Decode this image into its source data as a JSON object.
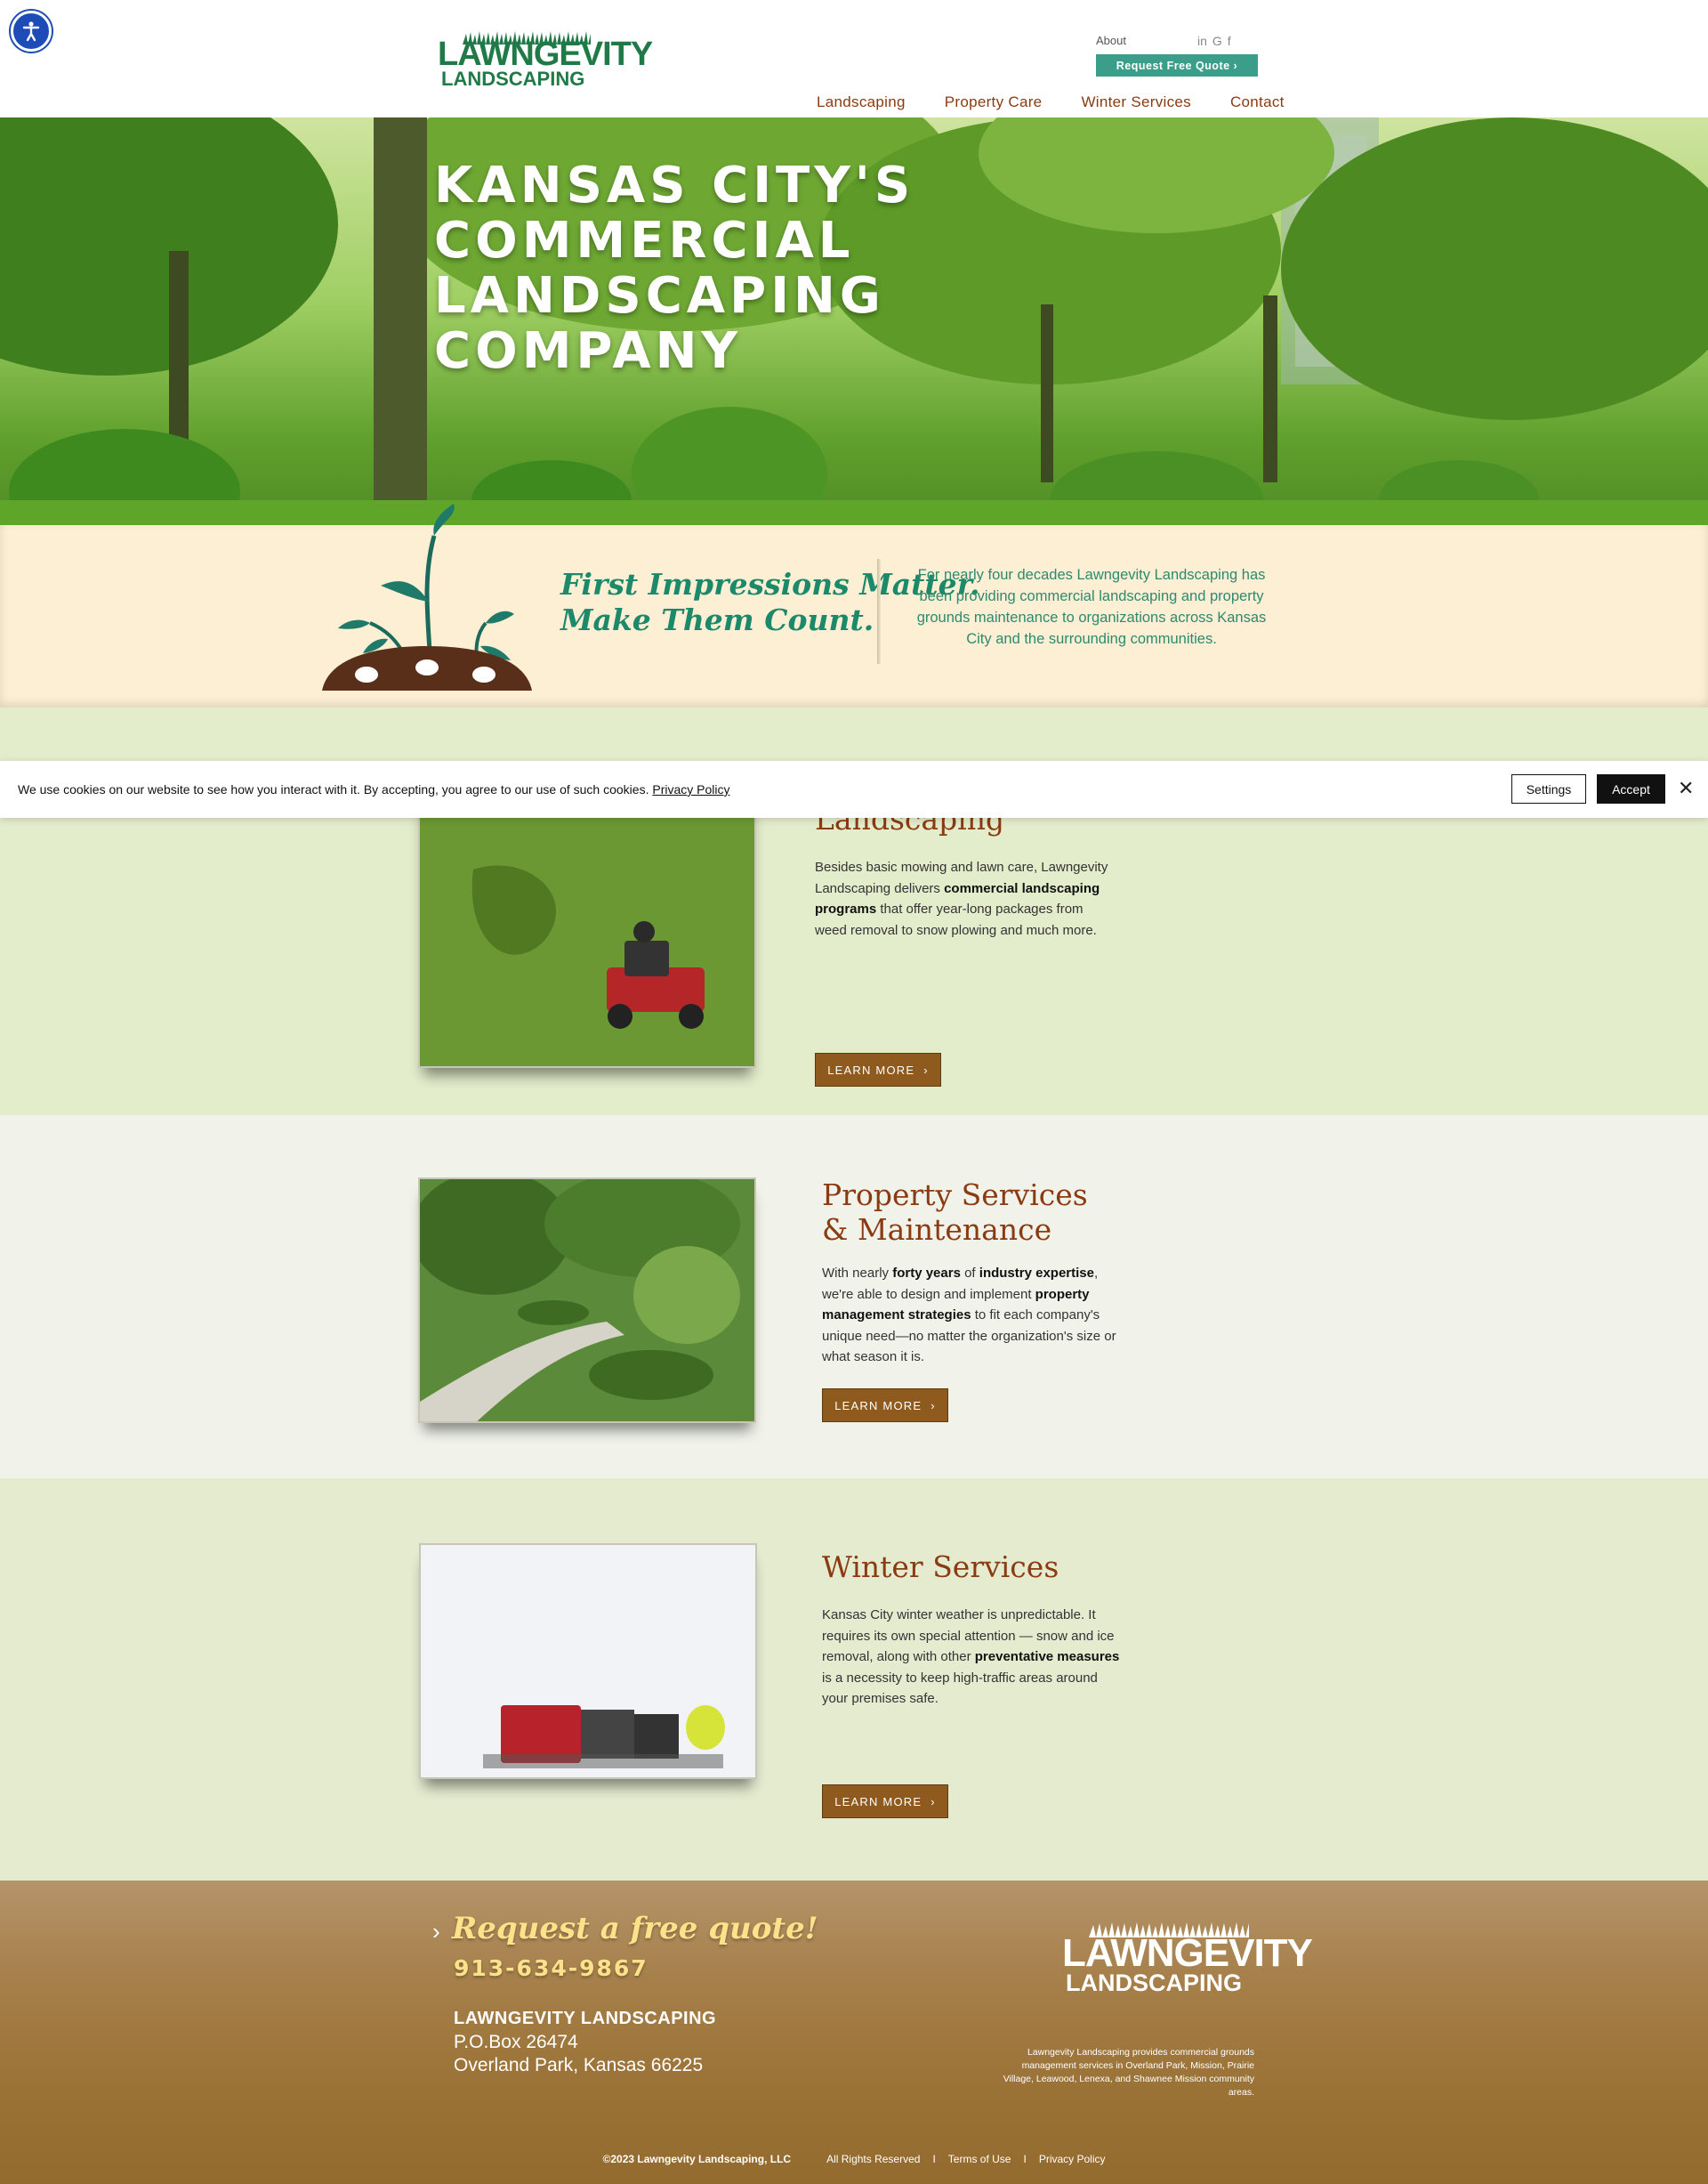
{
  "header": {
    "logo_line1": "LAWNGEVITY",
    "logo_line2": "LANDSCAPING",
    "about": "About",
    "social": [
      "in",
      "G",
      "f"
    ],
    "quote_button": "Request Free Quote ›",
    "nav": [
      "Landscaping",
      "Property Care",
      "Winter Services",
      "Contact"
    ]
  },
  "hero": {
    "title": "KANSAS CITY'S COMMERCIAL LANDSCAPING COMPANY"
  },
  "intro": {
    "tagline_line1": "First Impressions Matter.",
    "tagline_line2": "Make Them Count.",
    "text": "For nearly four decades Lawngevity Landscaping has been providing commercial landscaping and property grounds maintenance to organizations across Kansas City and the surrounding communities."
  },
  "cookie": {
    "text": "We use cookies on our website to see how you interact with it. By accepting, you agree to our use of such cookies.",
    "policy_link": "Privacy Policy",
    "settings": "Settings",
    "accept": "Accept",
    "close": "✕"
  },
  "services": [
    {
      "title": "Landscaping",
      "text_parts": [
        "Besides basic mowing and lawn care, Lawngevity Landscaping delivers ",
        "commercial landscaping programs",
        " that offer year-long packages from weed removal to snow plowing and much more."
      ],
      "button": "LEARN MORE"
    },
    {
      "title_line1": "Property Services",
      "title_line2": "& Maintenance",
      "text_parts": [
        "With nearly ",
        "forty years",
        " of ",
        "industry expertise",
        ", we're able to design and implement ",
        "property management strategies",
        " to fit each company's unique need—no matter the organization's size or what season it is."
      ],
      "button": "LEARN MORE"
    },
    {
      "title": "Winter Services",
      "text_parts": [
        "Kansas City winter weather is unpredictable. It requires its own special attention — snow and ice removal, along with other ",
        "preventative measures",
        " is a necessity to keep high-traffic areas around your premises safe."
      ],
      "button": "LEARN MORE"
    }
  ],
  "footer": {
    "quote": "Request a free quote!",
    "arrow": "›",
    "phone": "913-634-9867",
    "company": "LAWNGEVITY LANDSCAPING",
    "address1": "P.O.Box 26474",
    "address2": "Overland Park, Kansas 66225",
    "logo_line1": "LAWNGEVITY",
    "logo_line2": "LANDSCAPING",
    "description": "Lawngevity Landscaping provides commercial grounds management services in Overland Park, Mission, Prairie Village, Leawood, Lenexa, and Shawnee Mission community areas.",
    "copyright": "©2023 Lawngevity Landscaping, LLC",
    "rights": "All Rights Reserved",
    "sep": "I",
    "terms": "Terms of Use",
    "privacy": "Privacy Policy"
  },
  "colors": {
    "brand_green": "#1f7a47",
    "teal": "#3a9e8a",
    "nav_brown": "#8a3b12",
    "button_brown": "#8e5a1e",
    "intro_bg": "#fdefd4"
  }
}
